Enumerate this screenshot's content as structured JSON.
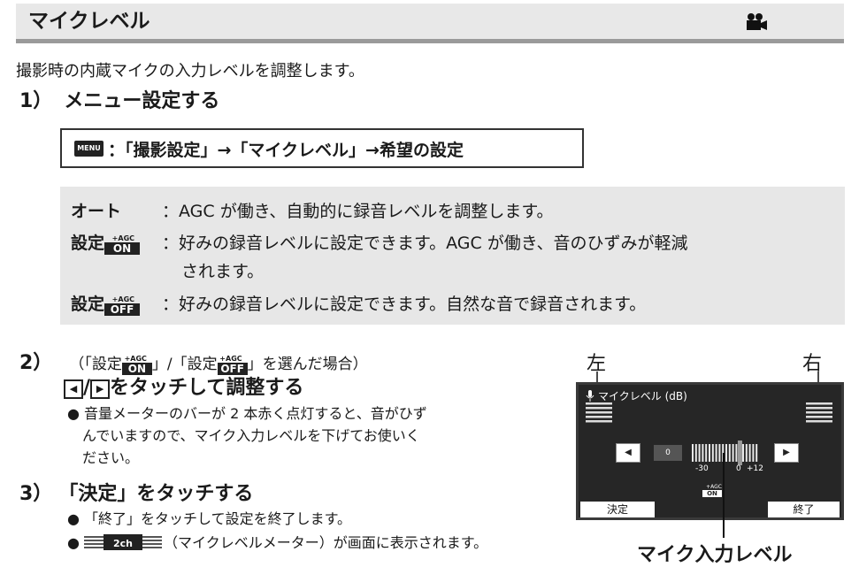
{
  "header": {
    "title": "マイクレベル",
    "icon": "movie-camera-icon"
  },
  "intro": "撮影時の内蔵マイクの入力レベルを調整します。",
  "step1": {
    "num": "1）",
    "title": "メニュー設定する"
  },
  "menu": {
    "icon_label": "MENU",
    "path": "：「撮影設定」→「マイクレベル」→希望の設定"
  },
  "options": [
    {
      "label": "オート",
      "desc": "：AGC が働き、自動的に録音レベルを調整します。"
    },
    {
      "label": "設定",
      "badge": "ON",
      "desc": "：好みの録音レベルに設定できます。AGC が働き、音のひずみが軽減",
      "desc2": "されます。"
    },
    {
      "label": "設定",
      "badge": "OFF",
      "desc": "：好みの録音レベルに設定できます。自然な音で録音されます。"
    }
  ],
  "agc_label": "+AGC",
  "step2": {
    "num": "2）",
    "condition_a": "（「設定",
    "condition_b": "」/「設定",
    "condition_c": "」を選んだ場合）",
    "left_btn": "◀",
    "sep": "/",
    "right_btn": "▶",
    "title": "をタッチして調整する",
    "bullet_1": "音量メーターのバーが 2 本赤く点灯すると、音がひず",
    "bullet_2": "んでいますので、マイク入力レベルを下げてお使いく",
    "bullet_3": "ださい。"
  },
  "step3": {
    "num": "3）",
    "title": "「決定」をタッチする",
    "bullet_a": "「終了」をタッチして設定を終了します。",
    "meter_text": "2ch",
    "bullet_b": "（マイクレベルメーター）が画面に表示されます。"
  },
  "figure": {
    "left_label": "左",
    "right_label": "右",
    "caption": "マイク入力レベル",
    "screen_title": "マイクレベル (dB)",
    "value": "0",
    "scale_min": "-30",
    "scale_mid": "0",
    "scale_max": "+12",
    "badge": "ON",
    "ok_button": "決定",
    "end_button": "終了",
    "level_fraction": 0.71
  }
}
